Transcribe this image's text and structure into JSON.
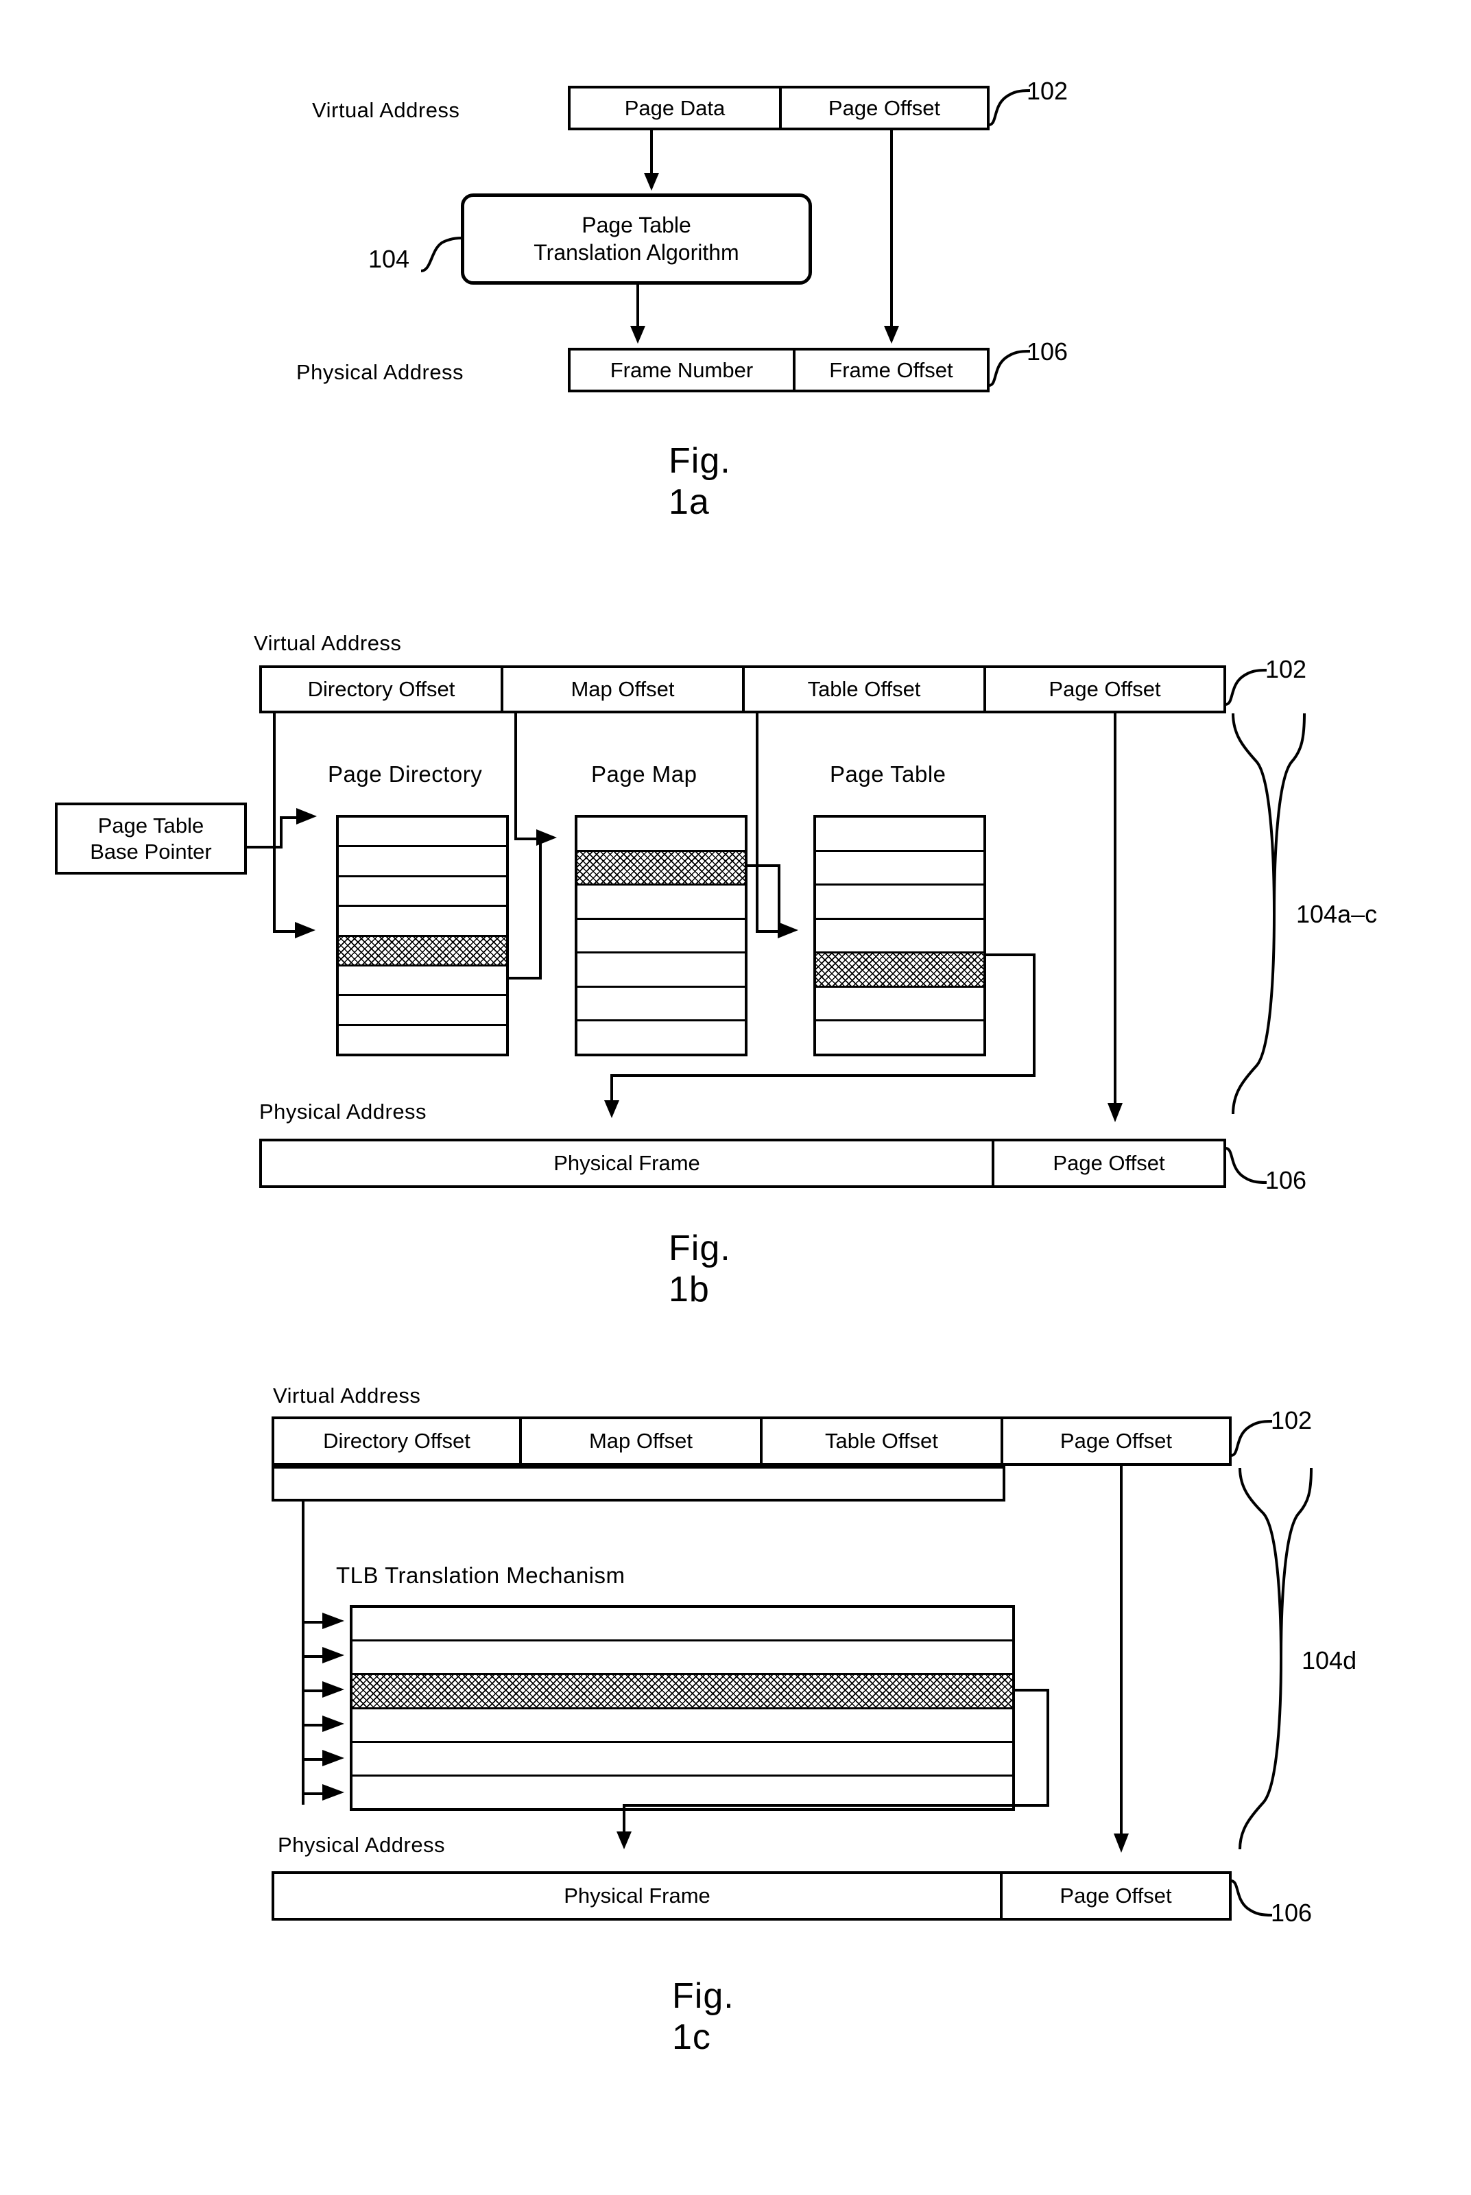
{
  "figures": [
    {
      "id": "fig1a",
      "caption": "Fig. 1a",
      "virtual_address_label": "Virtual Address",
      "physical_address_label": "Physical Address",
      "virtual_segments": [
        "Page Data",
        "Page Offset"
      ],
      "physical_segments": [
        "Frame Number",
        "Frame Offset"
      ],
      "process_box": [
        "Page Table",
        "Translation Algorithm"
      ],
      "refs": {
        "virtual_address": "102",
        "process": "104",
        "physical_address": "106"
      }
    },
    {
      "id": "fig1b",
      "caption": "Fig. 1b",
      "virtual_address_label": "Virtual Address",
      "physical_address_label": "Physical Address",
      "virtual_segments": [
        "Directory Offset",
        "Map Offset",
        "Table Offset",
        "Page Offset"
      ],
      "physical_segments": [
        "Physical Frame",
        "Page Offset"
      ],
      "base_pointer_box": [
        "Page Table",
        "Base Pointer"
      ],
      "tables": [
        {
          "title": "Page Directory",
          "rows": 8,
          "highlight_row": 5
        },
        {
          "title": "Page Map",
          "rows": 7,
          "highlight_row": 2
        },
        {
          "title": "Page Table",
          "rows": 7,
          "highlight_row": 5
        }
      ],
      "refs": {
        "virtual_address": "102",
        "translation": "104a–c",
        "physical_address": "106"
      }
    },
    {
      "id": "fig1c",
      "caption": "Fig. 1c",
      "virtual_address_label": "Virtual Address",
      "physical_address_label": "Physical Address",
      "virtual_segments": [
        "Directory Offset",
        "Map Offset",
        "Table Offset",
        "Page Offset"
      ],
      "physical_segments": [
        "Physical Frame",
        "Page Offset"
      ],
      "tlb": {
        "title": "TLB Translation Mechanism",
        "rows": 6,
        "highlight_row": 3
      },
      "refs": {
        "virtual_address": "102",
        "translation": "104d",
        "physical_address": "106"
      }
    }
  ],
  "colors": {
    "ink": "#000000",
    "paper": "#ffffff"
  }
}
